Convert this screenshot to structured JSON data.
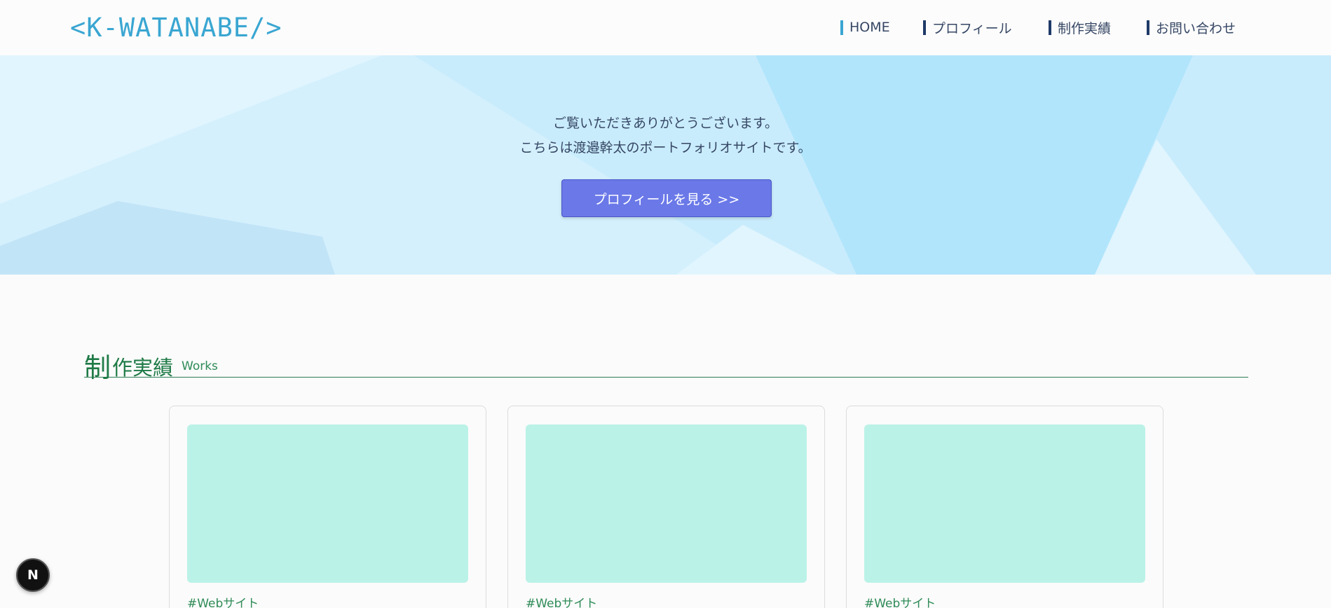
{
  "header": {
    "logo": "<K-WATANABE/>",
    "nav": [
      {
        "label": "HOME",
        "active": true
      },
      {
        "label": "プロフィール",
        "active": false
      },
      {
        "label": "制作実績",
        "active": false
      },
      {
        "label": "お問い合わせ",
        "active": false
      }
    ]
  },
  "hero": {
    "line1": "ご覧いただきありがとうございます。",
    "line2": "こちらは渡邉幹太のポートフォリオサイトです。",
    "button_label": "プロフィールを見る >>"
  },
  "works": {
    "title_first": "制",
    "title_rest": "作実績",
    "subtitle": "Works",
    "cards": [
      {
        "tag": "#Webサイト"
      },
      {
        "tag": "#Webサイト"
      },
      {
        "tag": "#Webサイト"
      }
    ]
  },
  "badge": {
    "label": "N"
  },
  "colors": {
    "accent": "#3aa6d2",
    "button": "#6a78e8",
    "works_green": "#1e7a46",
    "thumb": "#bbf2e7"
  }
}
